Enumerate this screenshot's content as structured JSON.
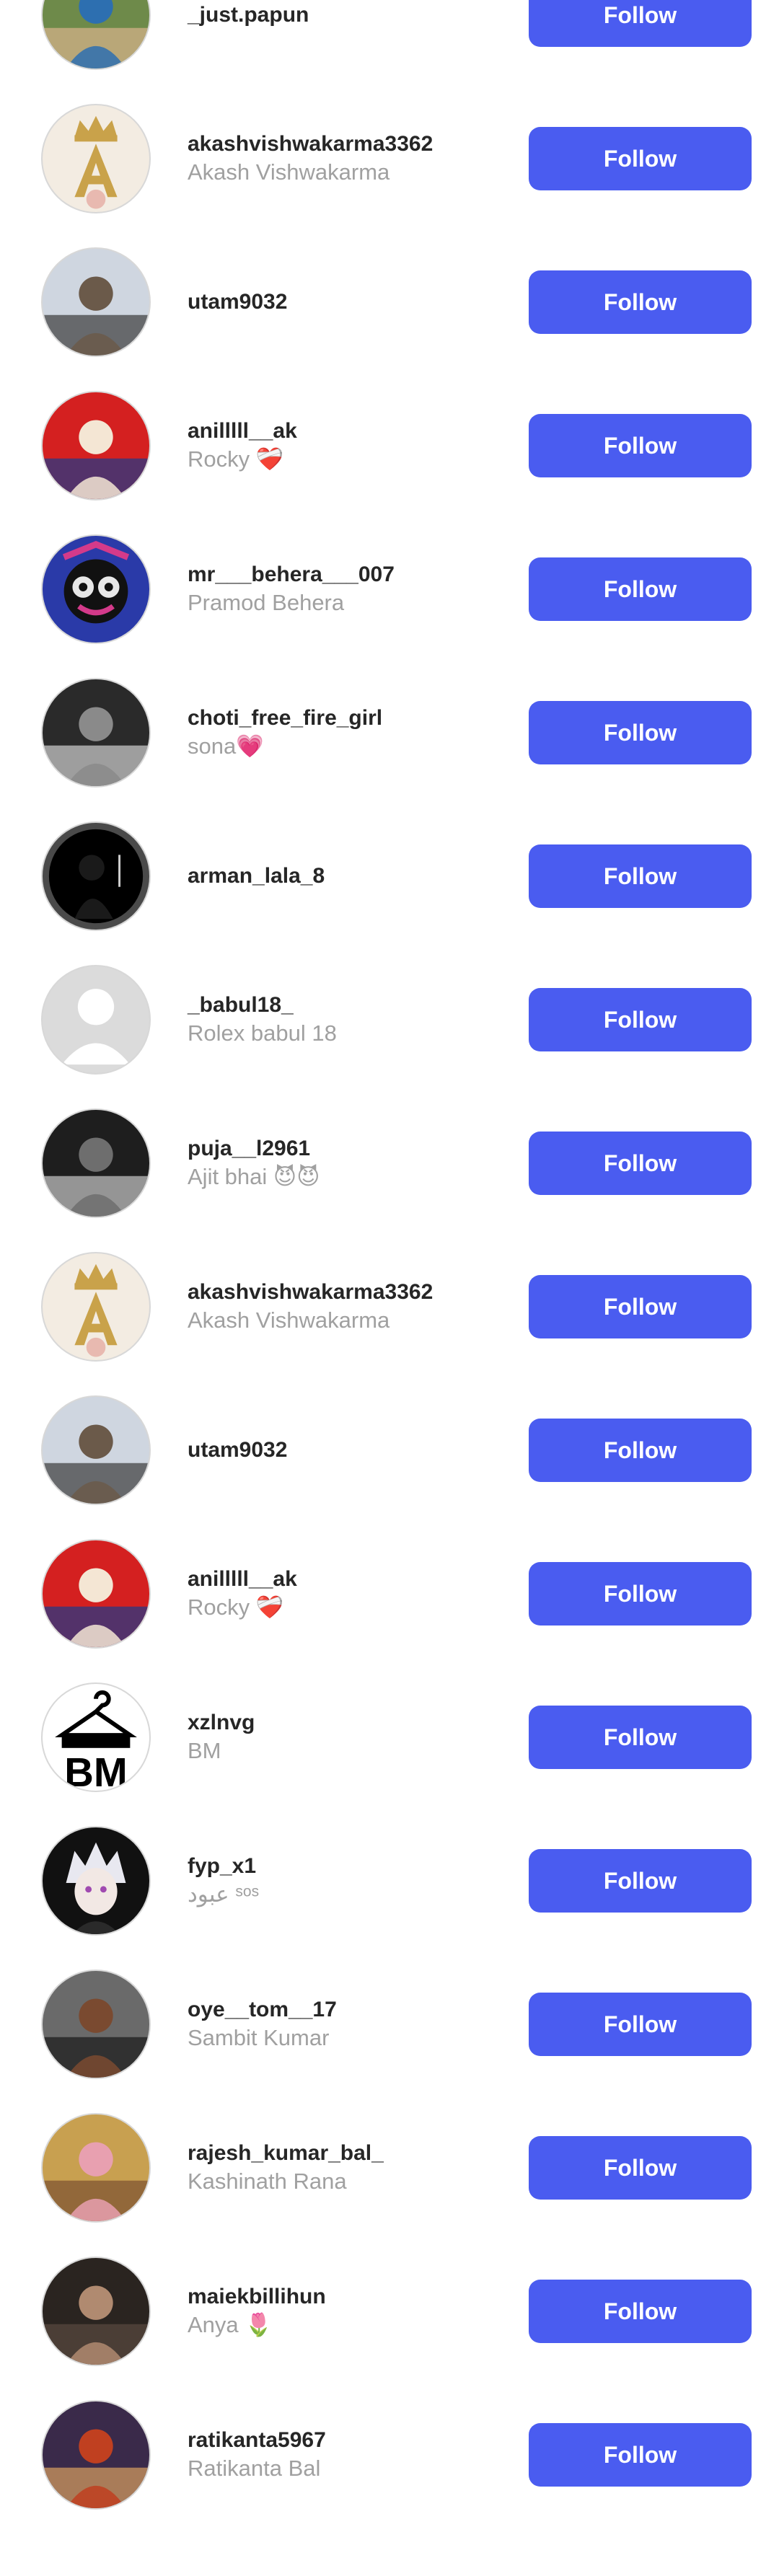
{
  "users": [
    {
      "username": "_just.papun",
      "full_name": "",
      "follow_label": "Follow",
      "avatar": "photo-man-sitting",
      "avatar_colors": [
        "#6e8a4a",
        "#2d6fb0",
        "#d9b38c"
      ]
    },
    {
      "username": "akashvishwakarma3362",
      "full_name": "Akash Vishwakarma",
      "follow_label": "Follow",
      "avatar": "crown-letter-a",
      "avatar_colors": [
        "#f3ece2",
        "#c9a24a",
        "#e8b9b0"
      ]
    },
    {
      "username": "utam9032",
      "full_name": "",
      "follow_label": "Follow",
      "avatar": "photo-temple-selfie",
      "avatar_colors": [
        "#cfd6e0",
        "#6b5a4a",
        "#3a3a3a"
      ]
    },
    {
      "username": "anilllll__ak",
      "full_name": "Rocky ❤️‍🩹",
      "follow_label": "Follow",
      "avatar": "photo-child-red",
      "avatar_colors": [
        "#d42020",
        "#f4e6d4",
        "#1d3a8a"
      ]
    },
    {
      "username": "mr___behera___007",
      "full_name": "Pramod Behera",
      "follow_label": "Follow",
      "avatar": "deity-jagannath",
      "avatar_colors": [
        "#2a3aa8",
        "#e8e8e8",
        "#d43a8a"
      ]
    },
    {
      "username": "choti_free_fire_girl",
      "full_name": "sona💗",
      "follow_label": "Follow",
      "avatar": "photo-girl-bw",
      "avatar_colors": [
        "#2a2a2a",
        "#8a8a8a",
        "#d0d0d0"
      ]
    },
    {
      "username": "arman_lala_8",
      "full_name": "",
      "follow_label": "Follow",
      "avatar": "silhouette-dark",
      "avatar_colors": [
        "#000000",
        "#4a4a4a",
        "#cfcfcf"
      ]
    },
    {
      "username": "_babul18_",
      "full_name": "Rolex babul 18",
      "follow_label": "Follow",
      "avatar": "default-avatar",
      "avatar_colors": [
        "#dbdbdb",
        "#ffffff",
        "#ffffff"
      ]
    },
    {
      "username": "puja__l2961",
      "full_name": "Ajit bhai 😈😈",
      "follow_label": "Follow",
      "avatar": "photo-girl-bw",
      "avatar_colors": [
        "#1e1e1e",
        "#6e6e6e",
        "#c8c8c8"
      ]
    },
    {
      "username": "akashvishwakarma3362",
      "full_name": "Akash Vishwakarma",
      "follow_label": "Follow",
      "avatar": "crown-letter-a",
      "avatar_colors": [
        "#f3ece2",
        "#c9a24a",
        "#e8b9b0"
      ]
    },
    {
      "username": "utam9032",
      "full_name": "",
      "follow_label": "Follow",
      "avatar": "photo-temple-selfie",
      "avatar_colors": [
        "#cfd6e0",
        "#6b5a4a",
        "#3a3a3a"
      ]
    },
    {
      "username": "anilllll__ak",
      "full_name": "Rocky ❤️‍🩹",
      "follow_label": "Follow",
      "avatar": "photo-child-red",
      "avatar_colors": [
        "#d42020",
        "#f4e6d4",
        "#1d3a8a"
      ]
    },
    {
      "username": "xzlnvg",
      "full_name": "BM",
      "follow_label": "Follow",
      "avatar": "hanger-logo-bm",
      "avatar_colors": [
        "#ffffff",
        "#000000",
        "#000000"
      ]
    },
    {
      "username": "fyp_x1",
      "full_name": "عبود ˢᵒˢ",
      "follow_label": "Follow",
      "avatar": "anime-white-hair",
      "avatar_colors": [
        "#111111",
        "#e8e8f0",
        "#a04ab0"
      ]
    },
    {
      "username": "oye__tom__17",
      "full_name": "Sambit Kumar",
      "follow_label": "Follow",
      "avatar": "photo-man-smiling",
      "avatar_colors": [
        "#6a6a6a",
        "#7a4a30",
        "#1a1a1a"
      ]
    },
    {
      "username": "rajesh_kumar_bal_",
      "full_name": "Kashinath Rana",
      "follow_label": "Follow",
      "avatar": "photo-man-pink-shirt",
      "avatar_colors": [
        "#c8a050",
        "#e8a0b0",
        "#7a5030"
      ]
    },
    {
      "username": "maiekbillihun",
      "full_name": "Anya 🌷",
      "follow_label": "Follow",
      "avatar": "photo-girl-sepia",
      "avatar_colors": [
        "#2a2420",
        "#b08a70",
        "#5a4a40"
      ]
    },
    {
      "username": "ratikanta5967",
      "full_name": "Ratikanta Bal",
      "follow_label": "Follow",
      "avatar": "photo-man-festival",
      "avatar_colors": [
        "#3a2a4a",
        "#c04020",
        "#d8a060"
      ]
    }
  ]
}
